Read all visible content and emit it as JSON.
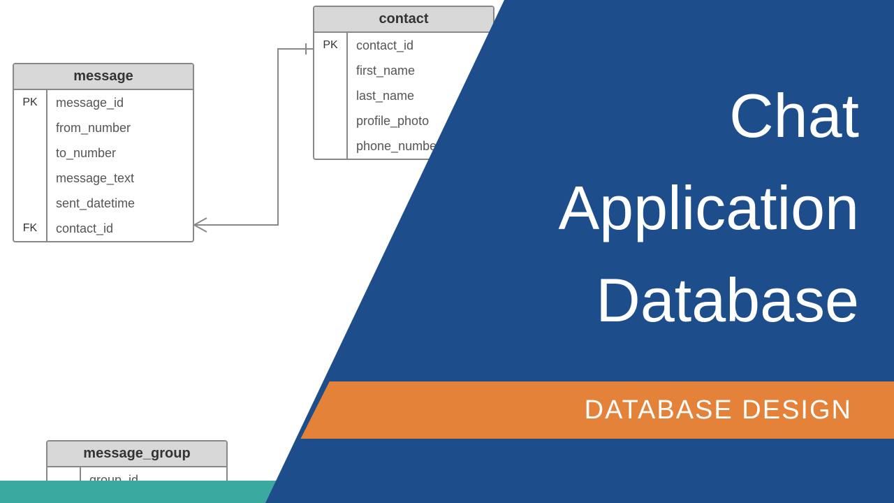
{
  "title": {
    "line1": "Chat",
    "line2": "Application",
    "line3": "Database"
  },
  "subtitle": "DATABASE DESIGN",
  "colors": {
    "blue": "#1d4d8b",
    "orange": "#e38238",
    "teal": "#3aa9a0",
    "header_gray": "#d8d8d8",
    "border": "#888888"
  },
  "entities": {
    "message": {
      "name": "message",
      "rows": [
        {
          "key": "PK",
          "field": "message_id"
        },
        {
          "key": "",
          "field": "from_number"
        },
        {
          "key": "",
          "field": "to_number"
        },
        {
          "key": "",
          "field": "message_text"
        },
        {
          "key": "",
          "field": "sent_datetime"
        },
        {
          "key": "FK",
          "field": "contact_id"
        }
      ]
    },
    "contact": {
      "name": "contact",
      "rows": [
        {
          "key": "PK",
          "field": "contact_id"
        },
        {
          "key": "",
          "field": "first_name"
        },
        {
          "key": "",
          "field": "last_name"
        },
        {
          "key": "",
          "field": "profile_photo"
        },
        {
          "key": "",
          "field": "phone_number"
        }
      ]
    },
    "message_group": {
      "name": "message_group",
      "rows": [
        {
          "key": "",
          "field": "group_id"
        }
      ]
    }
  },
  "relationship": {
    "from": "message.contact_id",
    "to": "contact.contact_id",
    "from_cardinality": "many",
    "to_cardinality": "one"
  }
}
